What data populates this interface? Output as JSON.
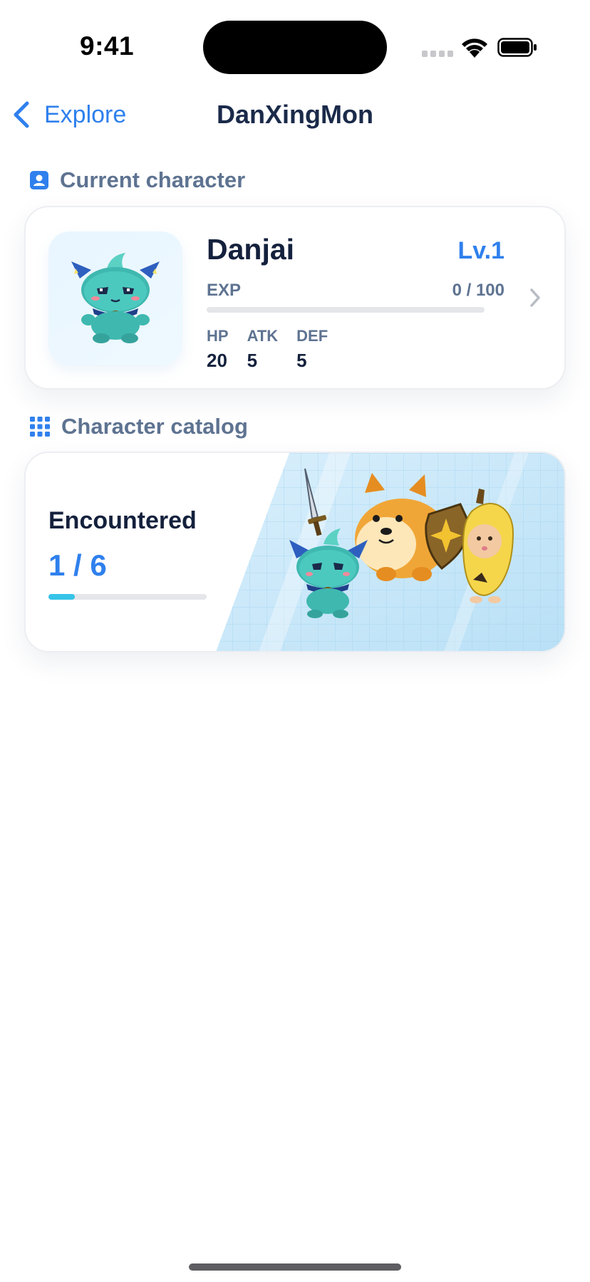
{
  "status_bar": {
    "time": "9:41",
    "signal_icon": "signal-icon",
    "wifi_icon": "wifi-icon",
    "battery_icon": "battery-icon"
  },
  "nav": {
    "back_label": "Explore",
    "back_icon": "chevron-left-icon",
    "title": "DanXingMon"
  },
  "current_section": {
    "icon": "contact-card-icon",
    "label": "Current character"
  },
  "character": {
    "name": "Danjai",
    "level": "Lv.1",
    "exp_label": "EXP",
    "exp_value": "0 / 100",
    "exp_fraction": 0.0,
    "stats": [
      {
        "label": "HP",
        "value": "20"
      },
      {
        "label": "ATK",
        "value": "5"
      },
      {
        "label": "DEF",
        "value": "5"
      }
    ],
    "avatar_icon": "danjai-avatar",
    "chevron_icon": "chevron-right-icon"
  },
  "catalog_section": {
    "icon": "grid-icon",
    "label": "Character catalog"
  },
  "catalog": {
    "encountered_label": "Encountered",
    "encountered_value": "1 / 6",
    "encountered_fraction": 0.1667,
    "art_icon": "character-group-illustration"
  },
  "colors": {
    "accent": "#2f80ed",
    "progress": "#36c3e8",
    "title": "#14213d",
    "secondary": "#5e7391"
  }
}
